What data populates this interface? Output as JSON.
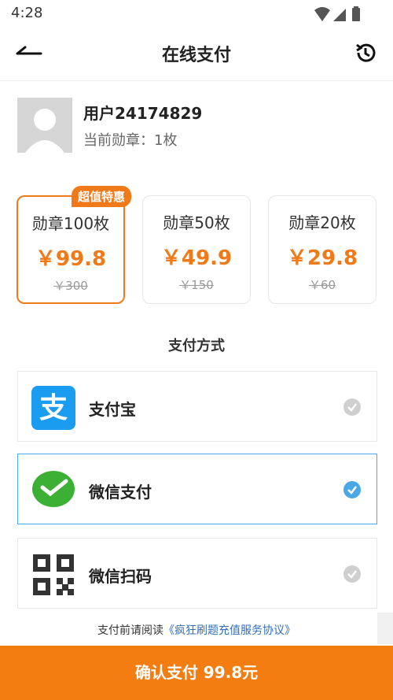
{
  "status": {
    "time": "4:28"
  },
  "header": {
    "title": "在线支付"
  },
  "user": {
    "name": "用户24174829",
    "badges": "当前勋章：1枚"
  },
  "packages": [
    {
      "name": "勋章100枚",
      "price": "￥99.8",
      "original": "￥300",
      "tag": "超值特惠",
      "selected": true
    },
    {
      "name": "勋章50枚",
      "price": "￥49.9",
      "original": "￥150",
      "selected": false
    },
    {
      "name": "勋章20枚",
      "price": "￥29.8",
      "original": "￥60",
      "selected": false
    }
  ],
  "payment": {
    "title": "支付方式",
    "methods": [
      {
        "label": "支付宝",
        "icon": "alipay-icon",
        "selected": false
      },
      {
        "label": "微信支付",
        "icon": "wechat-pay-icon",
        "selected": true
      },
      {
        "label": "微信扫码",
        "icon": "qr-code-icon",
        "selected": false
      }
    ]
  },
  "agreement": {
    "prefix": "支付前请阅读",
    "link": "《疯狂刷题充值服务协议》"
  },
  "confirm": {
    "label": "确认支付 99.8元"
  },
  "colors": {
    "accent": "#f47d12",
    "selected_border": "#4aa8e6",
    "link": "#2f6fb8",
    "check_active": "#4aa8e6",
    "check_inactive": "#cfcfcf"
  }
}
